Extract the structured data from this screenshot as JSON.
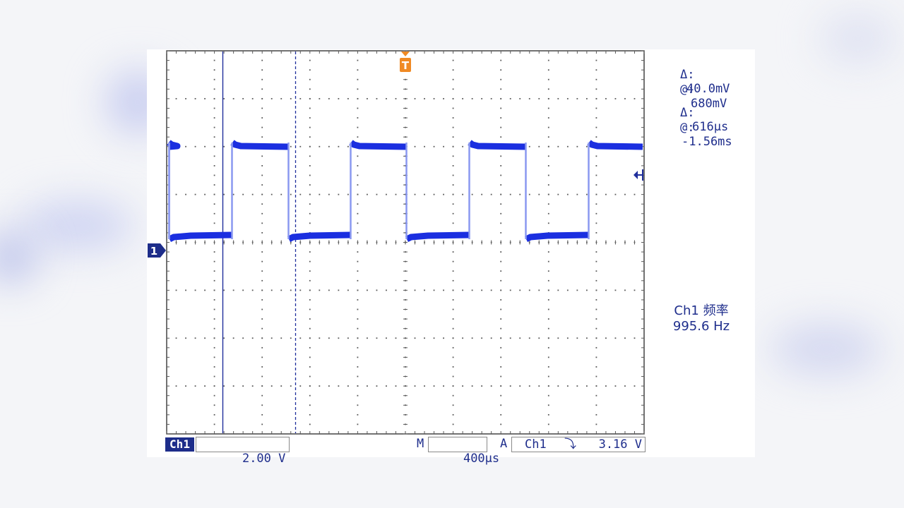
{
  "cursors": {
    "voltage_delta_symbol": "Δ:",
    "voltage_delta_value": "40.0mV",
    "voltage_at_symbol": "@:",
    "voltage_at_value": "680mV",
    "time_delta_symbol": "Δ:",
    "time_delta_value": "616µs",
    "time_at_symbol": "@:",
    "time_at_value": "-1.56ms"
  },
  "measurement": {
    "label": "Ch1 频率",
    "value": "995.6 Hz"
  },
  "status_bar": {
    "channel_tag": "Ch1",
    "volts_per_div": "2.00 V",
    "timebase_prefix": "M",
    "timebase_value": "400µs",
    "trigger_prefix": "A",
    "trigger_source": "Ch1",
    "trigger_slope_symbol": "⤵",
    "trigger_level": "3.16 V"
  },
  "markers": {
    "trigger_marker": "T",
    "channel_marker": "1"
  },
  "colors": {
    "trace": "#1b2fe0",
    "text": "#1f2e8c",
    "trigger_marker": "#f08a24",
    "grid": "#5a5a5a"
  }
}
